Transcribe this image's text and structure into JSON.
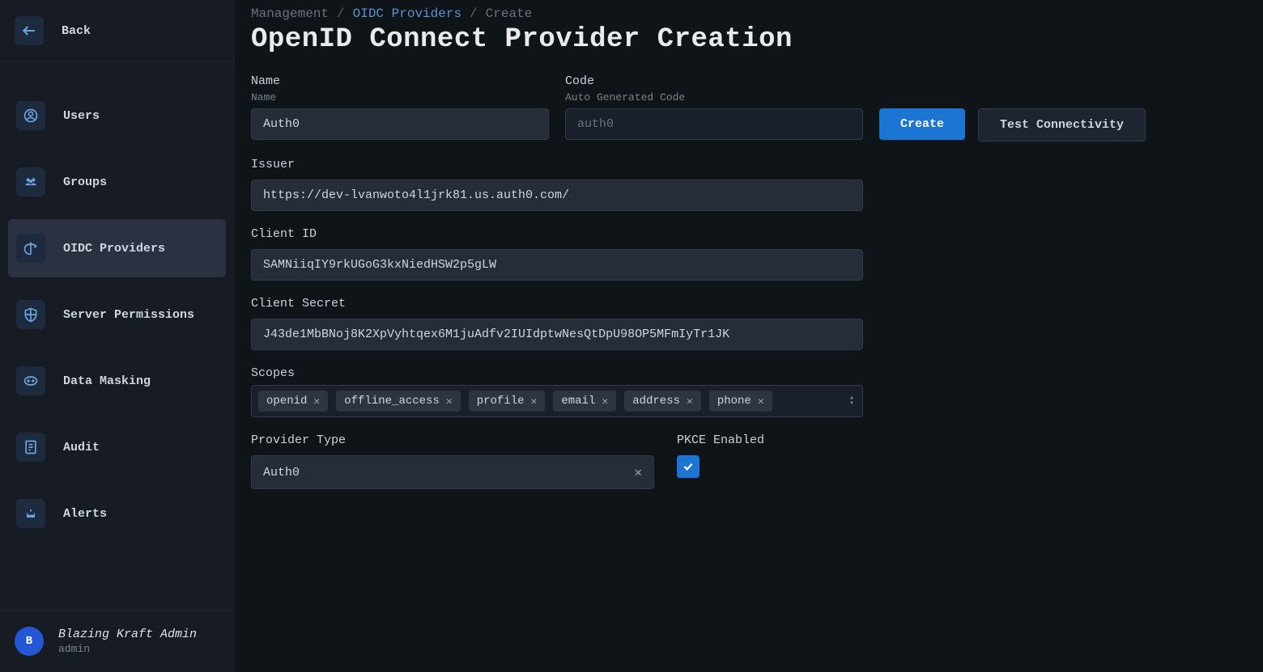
{
  "sidebar": {
    "back_label": "Back",
    "items": [
      {
        "label": "Users"
      },
      {
        "label": "Groups"
      },
      {
        "label": "OIDC Providers"
      },
      {
        "label": "Server Permissions"
      },
      {
        "label": "Data Masking"
      },
      {
        "label": "Audit"
      },
      {
        "label": "Alerts"
      }
    ],
    "footer": {
      "avatar_initial": "B",
      "name": "Blazing Kraft Admin",
      "role": "admin"
    }
  },
  "breadcrumb": {
    "root": "Management",
    "section": "OIDC Providers",
    "current": "Create"
  },
  "page_title": "OpenID Connect Provider Creation",
  "form": {
    "name_label": "Name",
    "name_sublabel": "Name",
    "name_value": "Auth0",
    "code_label": "Code",
    "code_sublabel": "Auto Generated Code",
    "code_placeholder": "auth0",
    "issuer_label": "Issuer",
    "issuer_value": "https://dev-lvanwoto4l1jrk81.us.auth0.com/",
    "client_id_label": "Client ID",
    "client_id_value": "SAMNiiqIY9rkUGoG3kxNiedHSW2p5gLW",
    "client_secret_label": "Client Secret",
    "client_secret_value": "J43de1MbBNoj8K2XpVyhtqex6M1juAdfv2IUIdptwNesQtDpU98OP5MFmIyTr1JK",
    "scopes_label": "Scopes",
    "scopes": [
      "openid",
      "offline_access",
      "profile",
      "email",
      "address",
      "phone"
    ],
    "provider_type_label": "Provider Type",
    "provider_type_value": "Auth0",
    "pkce_label": "PKCE Enabled",
    "pkce_checked": true
  },
  "actions": {
    "create": "Create",
    "test": "Test Connectivity"
  }
}
